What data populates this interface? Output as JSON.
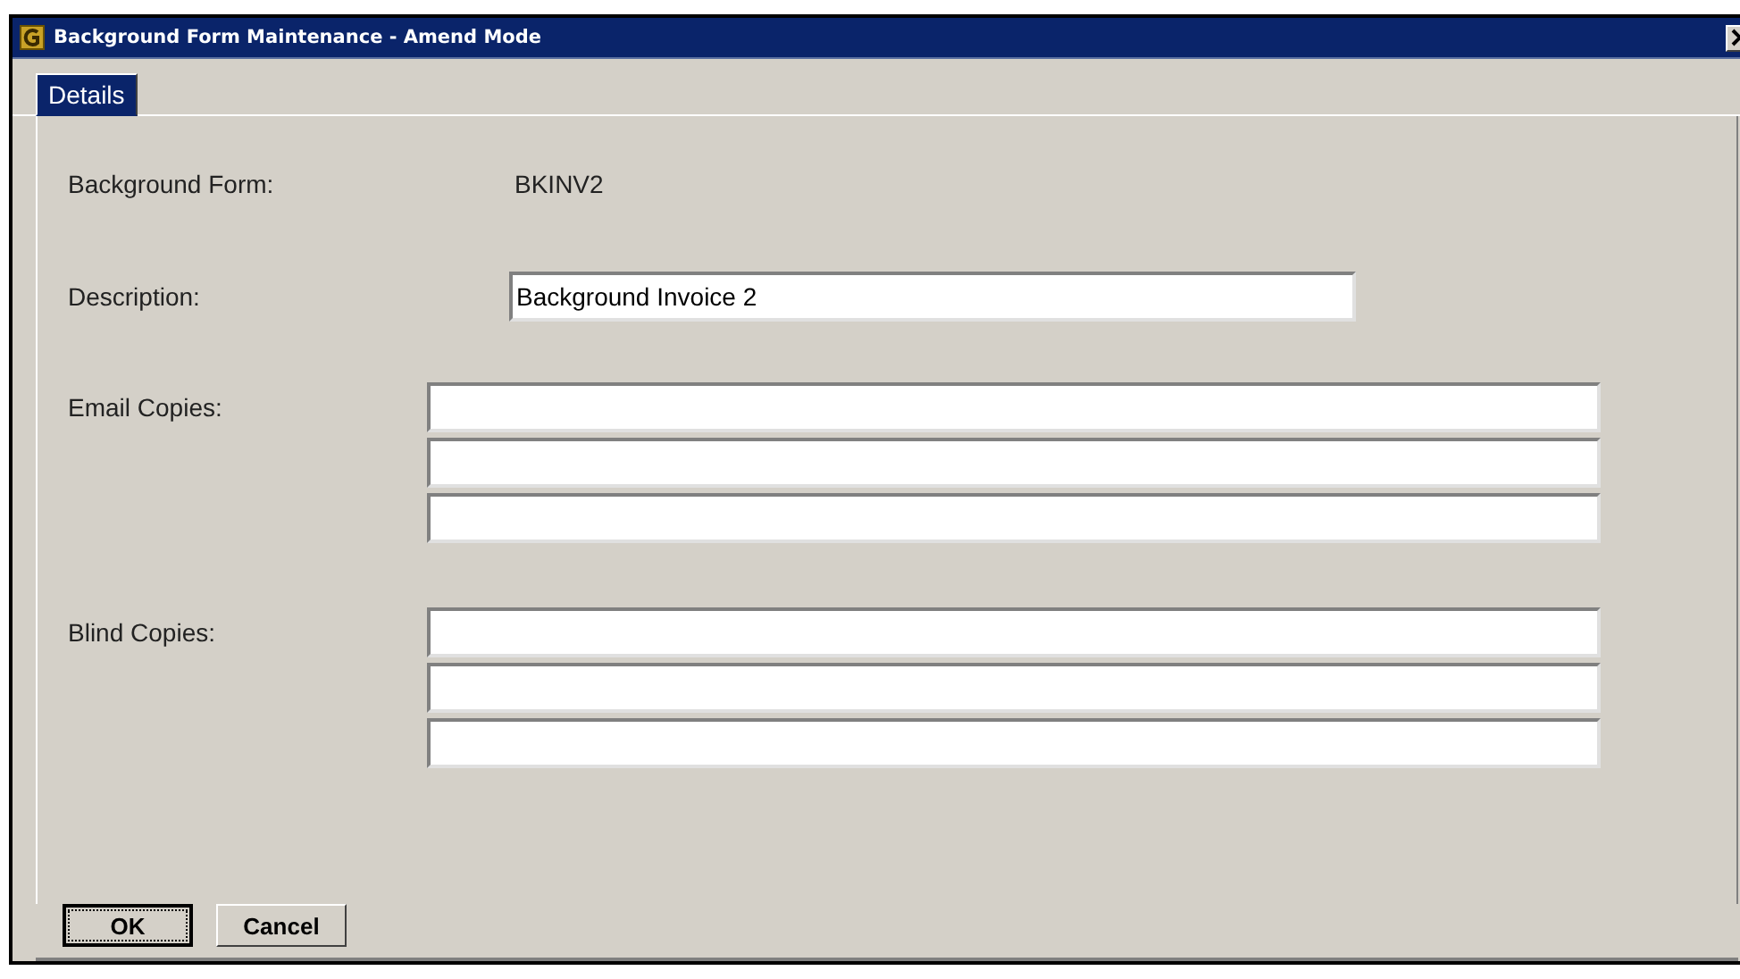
{
  "window": {
    "title": "Background Form Maintenance - Amend Mode"
  },
  "tabs": [
    {
      "label": "Details",
      "selected": true
    }
  ],
  "form": {
    "background_form": {
      "label": "Background Form:",
      "value": "BKINV2"
    },
    "description": {
      "label": "Description:",
      "value": "Background Invoice 2"
    },
    "email_copies": {
      "label": "Email Copies:",
      "fields": [
        {
          "kind": "text"
        },
        {
          "kind": "text"
        },
        {
          "kind": "text"
        }
      ]
    },
    "blind_copies": {
      "label": "Blind Copies:",
      "fields": [
        {
          "kind": "text"
        },
        {
          "kind": "text"
        },
        {
          "kind": "text"
        }
      ]
    }
  },
  "buttons": [
    {
      "label": "OK",
      "focused": true
    },
    {
      "label": "Cancel",
      "focused": false
    }
  ]
}
